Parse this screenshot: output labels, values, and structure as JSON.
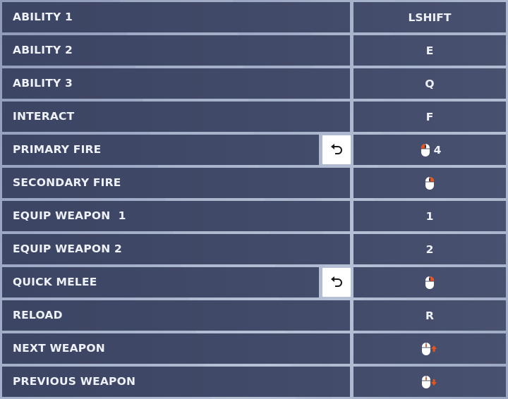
{
  "bindings": [
    {
      "action": "ABILITY 1",
      "key": "LSHIFT",
      "key_icon": "",
      "has_reset": false
    },
    {
      "action": "ABILITY 2",
      "key": "E",
      "key_icon": "",
      "has_reset": false
    },
    {
      "action": "ABILITY 3",
      "key": "Q",
      "key_icon": "",
      "has_reset": false
    },
    {
      "action": "INTERACT",
      "key": "F",
      "key_icon": "",
      "has_reset": false
    },
    {
      "action": "PRIMARY FIRE",
      "key": "4",
      "key_icon": "mouse-left-button-icon",
      "has_reset": true
    },
    {
      "action": "SECONDARY FIRE",
      "key": "",
      "key_icon": "mouse-right-button-icon",
      "has_reset": false
    },
    {
      "action": "EQUIP WEAPON  1",
      "key": "1",
      "key_icon": "",
      "has_reset": false
    },
    {
      "action": "EQUIP WEAPON 2",
      "key": "2",
      "key_icon": "",
      "has_reset": false
    },
    {
      "action": "QUICK MELEE",
      "key": "",
      "key_icon": "mouse-right-button-icon",
      "has_reset": true
    },
    {
      "action": "RELOAD",
      "key": "R",
      "key_icon": "",
      "has_reset": false
    },
    {
      "action": "NEXT WEAPON",
      "key": "",
      "key_icon": "mouse-wheel-up-icon",
      "has_reset": false
    },
    {
      "action": "PREVIOUS WEAPON",
      "key": "",
      "key_icon": "mouse-wheel-down-icon",
      "has_reset": false
    }
  ],
  "reset_icon": "undo-arrow-icon",
  "colors": {
    "row_background": "#3f4866",
    "text": "#eef1f8",
    "mouse_highlight": "#e8541c",
    "reset_button_bg": "#ffffff"
  }
}
